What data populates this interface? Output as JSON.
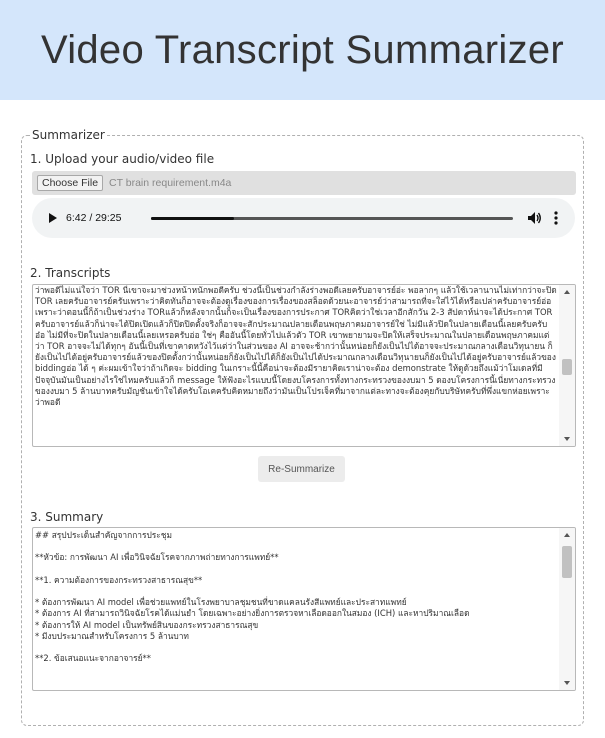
{
  "app": {
    "title": "Video Transcript Summarizer"
  },
  "panel": {
    "legend": "Summarizer"
  },
  "upload": {
    "label": "1. Upload your audio/video file",
    "button_label": "Choose File",
    "file_name": "CT brain requirement.m4a"
  },
  "audio_player": {
    "time": "6:42 / 29:25",
    "progress": 0.228
  },
  "transcripts": {
    "label": "2. Transcripts",
    "text": "ว่าพอดีไม่แน่ใจว่า TOR นี่เขาจะมาช่วงหน้าหนักพอดีครับ ช่วงนี้เป็นช่วงกำลังร่างพอดีเลยครับอาจารย์อ่ะ พอลากๆ แล้วใช้เวลานานไม่เท่ากว่าจะปิด TOR เลยครับอาจารย์ครับเพราะว่าคิดทันก็อาจจะต้องดูเรื่องของการเรื่องของสล็อตด้วยนะอาจารย์ว่าสามารถที่จะใส่ไว้ได้หรือเปล่าครับอาจารย์อ่อ เพราะว่าตอนนี้ก็ถ้าเป็นช่วงร่าง TORแล้วก็หลังจากนั้นก็จะเป็นเรื่องของการประกาศ TORคิดว่าใช่เวลาอีกสักวัน 2-3 สัปดาห์น่าจะได้ประกาศ TOR ครับอาจารย์แล้วก็น่าจะได้ปิดเปิดแล้วก็ปิดปิดตั้งจริงก็อาจจะสักประมาณปลายเดือนพฤษภาคมอาจารย์ใช่ ไม่มีแล้วปิดในปลายเดือนนี้เลยครับครับ อ๋อ ไม่มีที่จะปิดในปลายเดือนนี้เลยเหรอครับอ่อ ใช่ๆ คืออันนี้โดยทั่วไปแล้วตัว TOR เขาพยายามจะปิดให้เสร็จประมาณในปลายเดือนพฤษภาคมแต่ว่า TOR อาจจะไม่ได้ทุกๆ อันนี้เป็นที่เขาคาดหวังไว้แต่ว่าในส่วนของ AI อาจจะช้ากว่านั้นหน่อยก็ยังเป็นไปได้อาจจะประมาณกลางเดือนวิทุนายน ก็ยังเป็นไปได้อยู่ครับอาจารย์แล้วของปิดตั้งกว่านั้นหน่อยก็ยังเป็นไปได้ก็ยังเป็นไปได้ประมาณกลางเดือนวิทุนายนก็ยังเป็นไปได้อยู่ครับอาจารย์แล้วของ biddingอ่อ ได้ ๆ ค่ะผมเข้าใจว่าถ้าเกิดจะ bidding ในเกราะนี้นี้คือน่าจะต้องมีรายาคิดเราน่าจะต้อง demonstrate ให้ดูด้วยถึงแม้ว่าโมเดลที่มีปัจจุบันมันเป็นอย่างไรใช่ไหมครับแล้วก็ message ให้ฟังอะไรแบบนี้โดยงบโครงการทั้งทางกระทรวงของงบมา 5 ดองบโครงการนี้เนี่ยทางกระทรวงของงบมา 5 ล้านบาทครับมัญชันเข้าใจได้ครับโอเคครับคิดหมายถึงว่ามันเป็นโปรเจ็คที่มาจากแต่ละทางจะต้องคุยกับบริษัทครับที่พึ่งแขกห่อยเพราะว่าพอดี"
  },
  "resummarize_button": {
    "label": "Re-Summarize"
  },
  "summary": {
    "label": "3. Summary",
    "text": "## สรุปประเด็นสำคัญจากการประชุม\n\n**หัวข้อ: การพัฒนา AI เพื่อวินิจฉัยโรคจากภาพถ่ายทางการแพทย์**\n\n**1. ความต้องการของกระทรวงสาธารณสุข**\n\n* ต้องการพัฒนา AI model เพื่อช่วยแพทย์ในโรงพยาบาลชุมชนที่ขาดแคลนรังสีแพทย์และประสาทแพทย์\n* ต้องการ AI ที่สามารถวินิจฉัยโรคได้แม่นยำ โดยเฉพาะอย่างยิ่งการตรวจหาเลือดออกในสมอง (ICH) และหาปริมาณเลือด\n* ต้องการให้ AI model เป็นทรัพย์สินของกระทรวงสาธารณสุข\n* มีงบประมาณสำหรับโครงการ 5 ล้านบาท\n\n**2. ข้อเสนอแนะจากอาจารย์**"
  }
}
